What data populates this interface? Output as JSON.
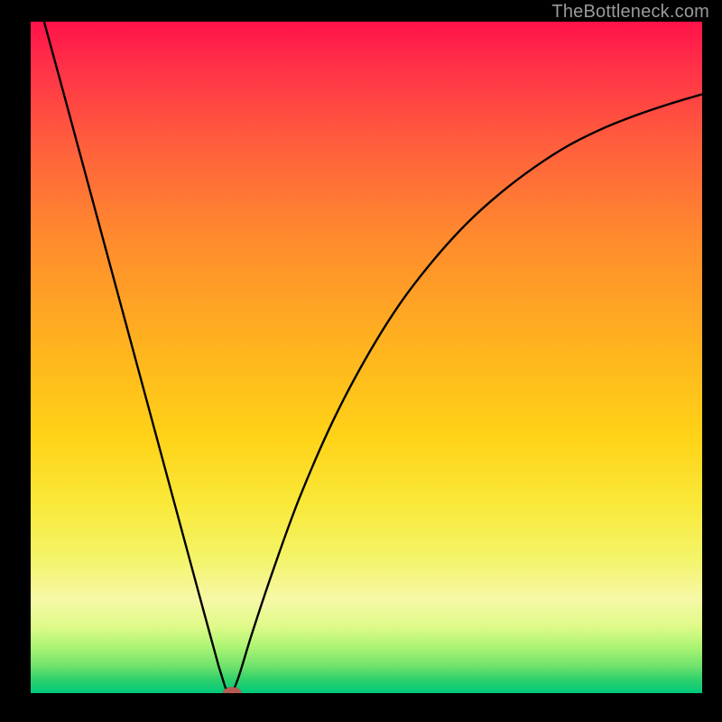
{
  "watermark": "TheBottleneck.com",
  "colors": {
    "background": "#000000",
    "gradient_top": "#ff124a",
    "gradient_mid": "#ffd318",
    "gradient_bottom": "#00c97a",
    "curve": "#000000",
    "marker_fill": "#b75a52",
    "marker_stroke": "#7a322b"
  },
  "chart_data": {
    "type": "line",
    "title": "",
    "xlabel": "",
    "ylabel": "",
    "xlim": [
      0,
      100
    ],
    "ylim": [
      0,
      100
    ],
    "grid": false,
    "legend": false,
    "annotations": [],
    "series": [
      {
        "name": "left-branch",
        "x": [
          2,
          5,
          10,
          15,
          20,
          25,
          28,
          29,
          30
        ],
        "values": [
          100,
          89,
          70.5,
          52,
          33.5,
          15,
          4,
          0.8,
          0
        ]
      },
      {
        "name": "right-branch",
        "x": [
          30,
          31,
          33,
          36,
          40,
          45,
          50,
          55,
          60,
          65,
          70,
          75,
          80,
          85,
          90,
          95,
          100
        ],
        "values": [
          0,
          2.5,
          9,
          18,
          29,
          40.5,
          50,
          58,
          64.5,
          70,
          74.5,
          78.3,
          81.5,
          84,
          86,
          87.7,
          89.2
        ]
      }
    ],
    "marker": {
      "x": 30,
      "y": 0,
      "rx": 1.4,
      "ry": 0.9
    }
  }
}
